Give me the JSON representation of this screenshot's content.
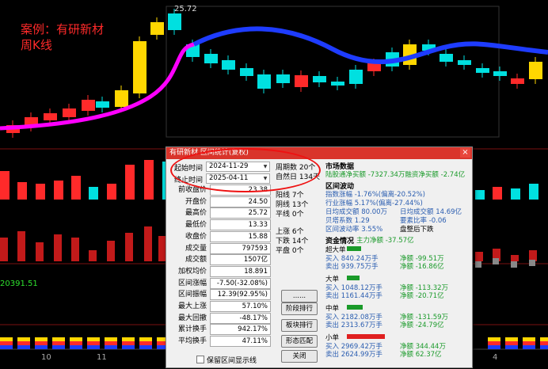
{
  "caption": {
    "line1": "案例：有研新材",
    "line2": "周K线"
  },
  "high_label": "25.72",
  "indicator_value": "20391.51",
  "x_ticks": [
    "10",
    "11",
    "4"
  ],
  "colors": {
    "up": "#ff2a2a",
    "down": "#00e0e0",
    "yellow": "#ffd700",
    "ma_blue": "#1e3cff",
    "ma_magenta": "#ff00ff",
    "dialog_title": "#d9342b"
  },
  "dialog": {
    "title": "有研新材 区间统计(复权)",
    "close_label": "×",
    "start_label": "起始时间",
    "start_value": "2024-11-29",
    "end_label": "终止时间",
    "end_value": "2025-04-11",
    "stats": [
      {
        "label": "前收盘价",
        "value": "23.38"
      },
      {
        "label": "开盘价",
        "value": "24.50"
      },
      {
        "label": "最高价",
        "value": "25.72"
      },
      {
        "label": "最低价",
        "value": "13.33"
      },
      {
        "label": "收盘价",
        "value": "15.88"
      },
      {
        "label": "成交量",
        "value": "797593"
      },
      {
        "label": "成交额",
        "value": "1507亿"
      },
      {
        "label": "加权均价",
        "value": "18.891"
      },
      {
        "label": "区间涨幅",
        "value": "-7.50(-32.08%)"
      },
      {
        "label": "区间振幅",
        "value": "12.39(92.95%)"
      },
      {
        "label": "最大上涨",
        "value": "57.10%"
      },
      {
        "label": "最大回撤",
        "value": "-48.17%"
      },
      {
        "label": "累计换手",
        "value": "942.17%"
      },
      {
        "label": "平均换手",
        "value": "47.11%"
      }
    ],
    "period": {
      "weeks": "周期数 20个",
      "days": "自然日 134天",
      "up": "阳线 7个",
      "down": "阴线 13个",
      "flat": "平线 0个",
      "rise": "上涨 6个",
      "fall": "下跌 14个",
      "even": "平盘 0个"
    },
    "buttons": [
      "......",
      "阶段排行",
      "板块排行",
      "形态匹配",
      "关闭"
    ],
    "keep_label": "保留区间显示线",
    "market": {
      "header": "市场数据",
      "line": "陆股通净买额 -7327.34万融资净买额 -2.74亿"
    },
    "range": {
      "header": "区间波动",
      "idx": "指数涨幅 -1.76%(偏离-20.52%)",
      "ind": "行业涨幅 5.17%(偏离-27.44%)",
      "avg_turn": "日均成交额 80.00万",
      "avg_turn2": "日均成交额 14.69亿",
      "beta": "贝塔系数 1.29",
      "pm": "要素比率 -0.06",
      "vol": "区间波动率 3.55%",
      "after": "盘整后下跌"
    },
    "fund": {
      "header": "资金情况",
      "main": "主力净额 -37.57亿",
      "groups": [
        {
          "name": "超大单",
          "buy": "买入 840.24万手",
          "sell": "卖出 939.75万手",
          "net1": "净额 -99.51万",
          "net2": "净额 -16.86亿",
          "color": "#1a9a2a"
        },
        {
          "name": "大单",
          "buy": "买入 1048.12万手",
          "sell": "卖出 1161.44万手",
          "net1": "净额 -113.32万",
          "net2": "净额 -20.71亿",
          "color": "#1a9a2a"
        },
        {
          "name": "中单",
          "buy": "买入 2182.08万手",
          "sell": "卖出 2313.67万手",
          "net1": "净额 -131.59万",
          "net2": "净额 -24.79亿",
          "color": "#1a9a2a"
        },
        {
          "name": "小单",
          "buy": "买入 2969.42万手",
          "sell": "卖出 2624.99万手",
          "net1": "净额 344.44万",
          "net2": "净额 62.37亿",
          "color": "#e02020"
        }
      ]
    }
  }
}
